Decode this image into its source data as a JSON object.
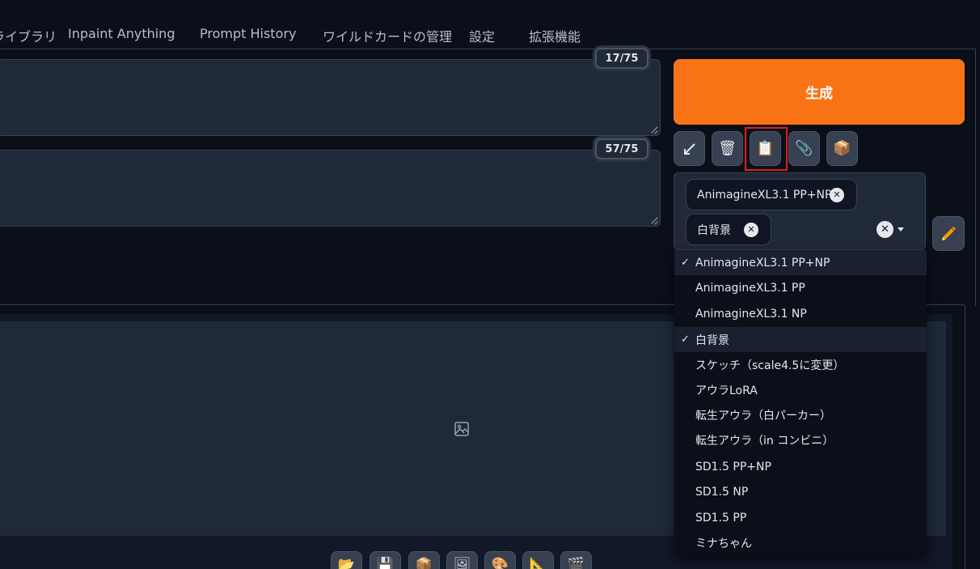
{
  "tabs": [
    {
      "label": "ライブラリ"
    },
    {
      "label": "Inpaint Anything"
    },
    {
      "label": "Prompt History"
    },
    {
      "label": "ワイルドカードの管理"
    },
    {
      "label": "設定"
    },
    {
      "label": "拡張機能"
    }
  ],
  "prompt": {
    "token_count": "17/75"
  },
  "negative_prompt": {
    "token_count": "57/75"
  },
  "generate_label": "生成",
  "tool_buttons": [
    {
      "name": "arrow-icon",
      "glyph": "↙"
    },
    {
      "name": "trash-icon",
      "glyph": "🗑"
    },
    {
      "name": "clipboard-icon",
      "glyph": "📋"
    },
    {
      "name": "paperclip-icon",
      "glyph": "📎"
    },
    {
      "name": "box-icon",
      "glyph": "📦"
    }
  ],
  "styles": {
    "selected": [
      {
        "label": "AnimagineXL3.1 PP+NP"
      },
      {
        "label": "白背景"
      }
    ],
    "options": [
      {
        "label": "AnimagineXL3.1 PP+NP",
        "checked": true
      },
      {
        "label": "AnimagineXL3.1 PP",
        "checked": false
      },
      {
        "label": "AnimagineXL3.1 NP",
        "checked": false
      },
      {
        "label": "白背景",
        "checked": true
      },
      {
        "label": "スケッチ（scale4.5に変更）",
        "checked": false
      },
      {
        "label": "アウラLoRA",
        "checked": false
      },
      {
        "label": "転生アウラ（白パーカー）",
        "checked": false
      },
      {
        "label": "転生アウラ（in コンビニ）",
        "checked": false
      },
      {
        "label": "SD1.5 PP+NP",
        "checked": false
      },
      {
        "label": "SD1.5 NP",
        "checked": false
      },
      {
        "label": "SD1.5 PP",
        "checked": false
      },
      {
        "label": "ミナちゃん",
        "checked": false
      }
    ],
    "check_glyph": "✓",
    "remove_glyph": "✕"
  },
  "action_buttons": [
    {
      "name": "folder-icon",
      "glyph": "📂"
    },
    {
      "name": "save-icon",
      "glyph": "💾"
    },
    {
      "name": "archive-icon",
      "glyph": "📦"
    },
    {
      "name": "image-icon",
      "glyph": "🖼"
    },
    {
      "name": "palette-icon",
      "glyph": "🎨"
    },
    {
      "name": "triangle-ruler-icon",
      "glyph": "📐"
    },
    {
      "name": "clapper-icon",
      "glyph": "🎬"
    }
  ],
  "colors": {
    "accent": "#f97316",
    "highlight": "#e11d1d"
  }
}
